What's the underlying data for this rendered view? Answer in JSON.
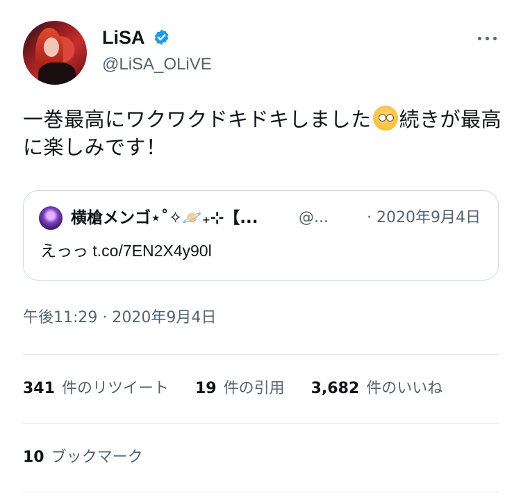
{
  "author": {
    "display_name": "LiSA",
    "handle": "@LiSA_OLiVE",
    "verified": true,
    "avatar_icon": "profile-photo"
  },
  "tweet": {
    "text_before_emoji": "一巻最高にワクワクドキドキしました",
    "emoji": "pleading-face-emoji",
    "text_after_emoji": "続きが最高に楽しみです！"
  },
  "quoted_tweet": {
    "display_name": "横槍メンゴ⋆˚✧🪐₊⊹【...",
    "handle": "@...",
    "date": "· 2020年9月4日",
    "text": "えっっ t.co/7EN2X4y90l"
  },
  "timestamp": "午後11:29 · 2020年9月4日",
  "stats": [
    {
      "count": "341",
      "label": "件のリツイート"
    },
    {
      "count": "19",
      "label": "件の引用"
    },
    {
      "count": "3,682",
      "label": "件のいいね"
    }
  ],
  "bookmarks": {
    "count": "10",
    "label": "ブックマーク"
  },
  "colors": {
    "verified_blue": "#1d9bf0",
    "secondary_text": "#536471",
    "border": "#cfd9de"
  }
}
